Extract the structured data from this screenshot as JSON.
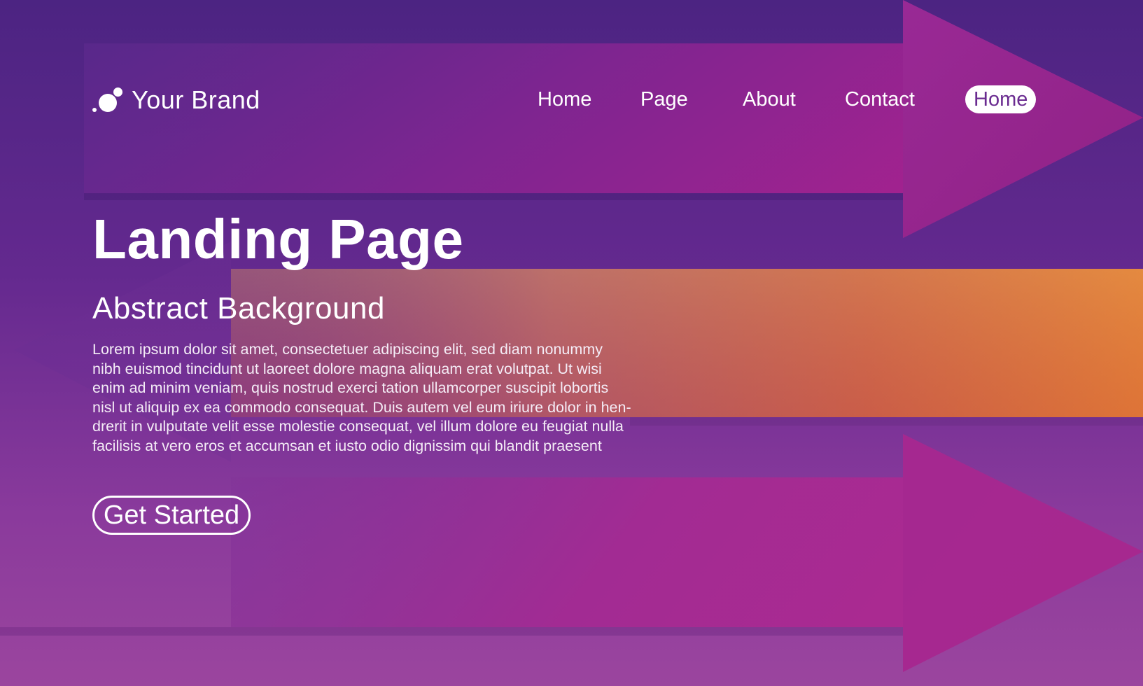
{
  "brand": {
    "name": "Your Brand",
    "logo_icon": "bubbles-logo-icon"
  },
  "nav": {
    "items": [
      {
        "label": "Home",
        "active": false
      },
      {
        "label": "Page",
        "active": false
      },
      {
        "label": "About",
        "active": false
      },
      {
        "label": "Contact",
        "active": false
      },
      {
        "label": "Home",
        "active": true
      }
    ]
  },
  "hero": {
    "title": "Landing Page",
    "subtitle": "Abstract Background",
    "body_lines": [
      "Lorem ipsum dolor sit amet, consectetuer adipiscing elit, sed diam nonummy",
      "nibh euismod tincidunt ut laoreet dolore magna aliquam erat volutpat. Ut wisi",
      "enim ad minim veniam, quis nostrud exerci tation ullamcorper suscipit lobortis",
      "nisl ut aliquip ex ea commodo consequat. Duis autem vel eum iriure dolor in hen-",
      "drerit in vulputate velit esse molestie consequat, vel illum dolore eu feugiat nulla",
      "facilisis at vero eros et accumsan et iusto odio dignissim qui blandit praesent"
    ],
    "cta_label": "Get Started"
  },
  "colors": {
    "background_top": "#4c2482",
    "background_bottom": "#9b459e",
    "arrow_magenta": "#a62a92",
    "band_orange": "#e07a3a",
    "active_nav_text": "#6a2b90",
    "text": "#ffffff"
  }
}
